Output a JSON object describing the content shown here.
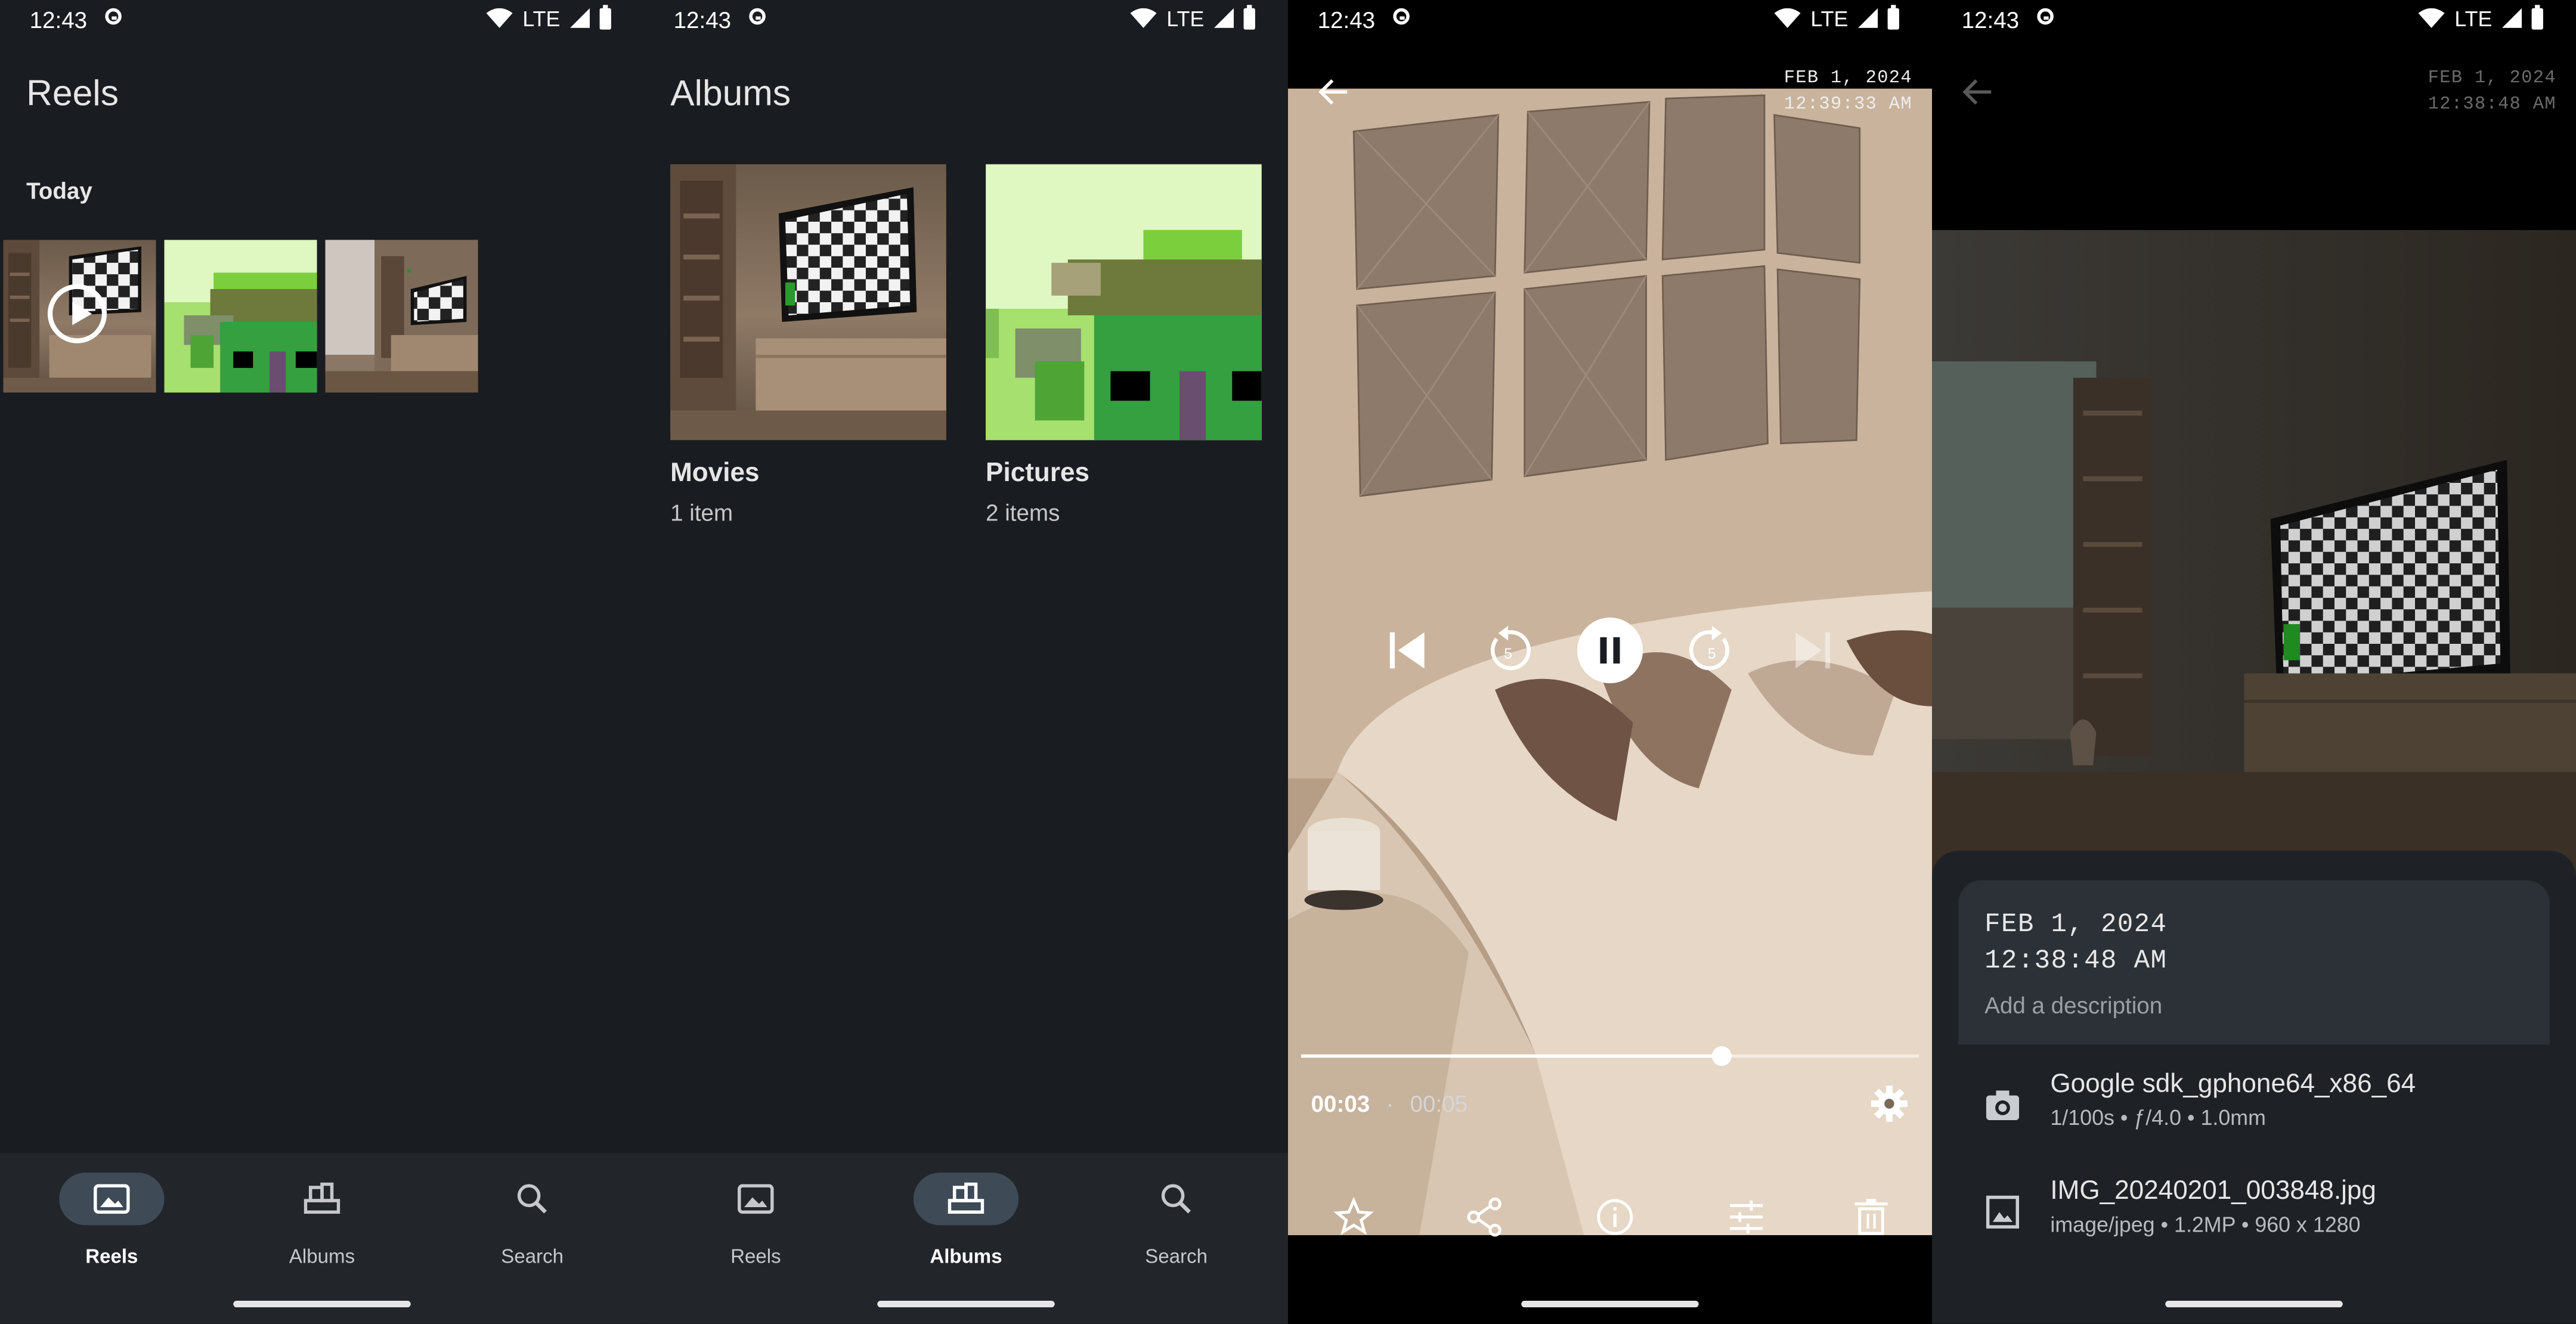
{
  "status_bar": {
    "time": "12:43",
    "network": "LTE"
  },
  "reels": {
    "title": "Reels",
    "section": "Today",
    "thumbnails": [
      {
        "kind": "video",
        "icon": "play-icon"
      },
      {
        "kind": "image"
      },
      {
        "kind": "image"
      }
    ]
  },
  "albums": {
    "title": "Albums",
    "items": [
      {
        "name": "Movies",
        "count": "1 item"
      },
      {
        "name": "Pictures",
        "count": "2 items"
      }
    ]
  },
  "nav": {
    "items": [
      {
        "label": "Reels",
        "icon": "image-icon"
      },
      {
        "label": "Albums",
        "icon": "albums-icon"
      },
      {
        "label": "Search",
        "icon": "search-icon"
      }
    ]
  },
  "player": {
    "date": "FEB 1, 2024",
    "time": "12:39:33 AM",
    "position": "00:03",
    "separator": "·",
    "duration": "00:05",
    "progress": 0.68,
    "skip_seconds": "5"
  },
  "details": {
    "date": "FEB 1, 2024",
    "time": "12:38:48 AM",
    "description_placeholder": "Add a description",
    "camera": {
      "model": "Google sdk_gphone64_x86_64",
      "exposure": "1/100s • ƒ/4.0 • 1.0mm"
    },
    "file": {
      "name": "IMG_20240201_003848.jpg",
      "meta": "image/jpeg • 1.2MP • 960 x 1280"
    }
  },
  "colors": {
    "background": "#191c20",
    "nav_bar": "#22262b",
    "active_pill": "#3e4a56",
    "accent_green": "#3aa63c"
  }
}
